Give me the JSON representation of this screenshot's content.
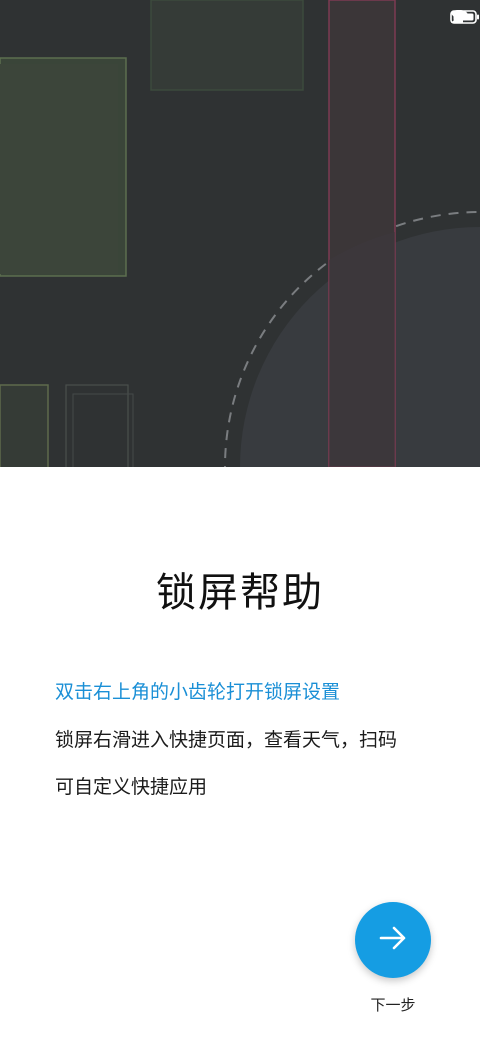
{
  "status_bar": {
    "icons": [
      "signal-icon",
      "wifi-icon",
      "battery-icon"
    ]
  },
  "colors": {
    "hero_background": "#2f3233",
    "accent": "#1a8fd6",
    "next_button": "#159de3"
  },
  "main": {
    "title": "锁屏帮助",
    "tips": [
      "双击右上角的小齿轮打开锁屏设置",
      "锁屏右滑进入快捷页面，查看天气，扫码",
      "可自定义快捷应用"
    ]
  },
  "footer": {
    "next_icon": "arrow-right-icon",
    "next_label": "下一步"
  }
}
